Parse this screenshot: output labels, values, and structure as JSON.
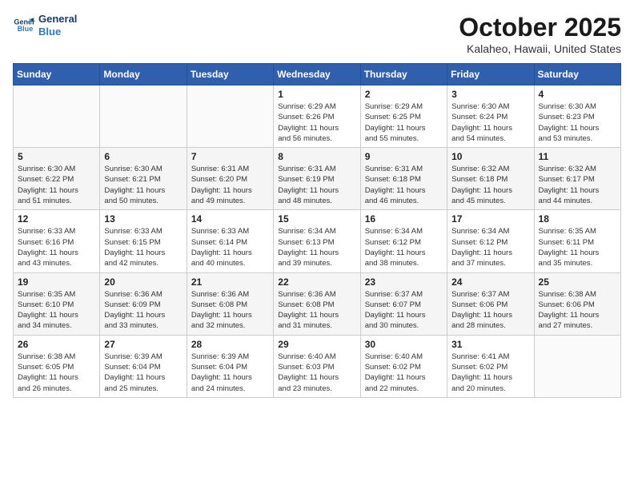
{
  "header": {
    "logo_line1": "General",
    "logo_line2": "Blue",
    "month": "October 2025",
    "location": "Kalaheo, Hawaii, United States"
  },
  "weekdays": [
    "Sunday",
    "Monday",
    "Tuesday",
    "Wednesday",
    "Thursday",
    "Friday",
    "Saturday"
  ],
  "weeks": [
    [
      {
        "day": "",
        "info": ""
      },
      {
        "day": "",
        "info": ""
      },
      {
        "day": "",
        "info": ""
      },
      {
        "day": "1",
        "info": "Sunrise: 6:29 AM\nSunset: 6:26 PM\nDaylight: 11 hours\nand 56 minutes."
      },
      {
        "day": "2",
        "info": "Sunrise: 6:29 AM\nSunset: 6:25 PM\nDaylight: 11 hours\nand 55 minutes."
      },
      {
        "day": "3",
        "info": "Sunrise: 6:30 AM\nSunset: 6:24 PM\nDaylight: 11 hours\nand 54 minutes."
      },
      {
        "day": "4",
        "info": "Sunrise: 6:30 AM\nSunset: 6:23 PM\nDaylight: 11 hours\nand 53 minutes."
      }
    ],
    [
      {
        "day": "5",
        "info": "Sunrise: 6:30 AM\nSunset: 6:22 PM\nDaylight: 11 hours\nand 51 minutes."
      },
      {
        "day": "6",
        "info": "Sunrise: 6:30 AM\nSunset: 6:21 PM\nDaylight: 11 hours\nand 50 minutes."
      },
      {
        "day": "7",
        "info": "Sunrise: 6:31 AM\nSunset: 6:20 PM\nDaylight: 11 hours\nand 49 minutes."
      },
      {
        "day": "8",
        "info": "Sunrise: 6:31 AM\nSunset: 6:19 PM\nDaylight: 11 hours\nand 48 minutes."
      },
      {
        "day": "9",
        "info": "Sunrise: 6:31 AM\nSunset: 6:18 PM\nDaylight: 11 hours\nand 46 minutes."
      },
      {
        "day": "10",
        "info": "Sunrise: 6:32 AM\nSunset: 6:18 PM\nDaylight: 11 hours\nand 45 minutes."
      },
      {
        "day": "11",
        "info": "Sunrise: 6:32 AM\nSunset: 6:17 PM\nDaylight: 11 hours\nand 44 minutes."
      }
    ],
    [
      {
        "day": "12",
        "info": "Sunrise: 6:33 AM\nSunset: 6:16 PM\nDaylight: 11 hours\nand 43 minutes."
      },
      {
        "day": "13",
        "info": "Sunrise: 6:33 AM\nSunset: 6:15 PM\nDaylight: 11 hours\nand 42 minutes."
      },
      {
        "day": "14",
        "info": "Sunrise: 6:33 AM\nSunset: 6:14 PM\nDaylight: 11 hours\nand 40 minutes."
      },
      {
        "day": "15",
        "info": "Sunrise: 6:34 AM\nSunset: 6:13 PM\nDaylight: 11 hours\nand 39 minutes."
      },
      {
        "day": "16",
        "info": "Sunrise: 6:34 AM\nSunset: 6:12 PM\nDaylight: 11 hours\nand 38 minutes."
      },
      {
        "day": "17",
        "info": "Sunrise: 6:34 AM\nSunset: 6:12 PM\nDaylight: 11 hours\nand 37 minutes."
      },
      {
        "day": "18",
        "info": "Sunrise: 6:35 AM\nSunset: 6:11 PM\nDaylight: 11 hours\nand 35 minutes."
      }
    ],
    [
      {
        "day": "19",
        "info": "Sunrise: 6:35 AM\nSunset: 6:10 PM\nDaylight: 11 hours\nand 34 minutes."
      },
      {
        "day": "20",
        "info": "Sunrise: 6:36 AM\nSunset: 6:09 PM\nDaylight: 11 hours\nand 33 minutes."
      },
      {
        "day": "21",
        "info": "Sunrise: 6:36 AM\nSunset: 6:08 PM\nDaylight: 11 hours\nand 32 minutes."
      },
      {
        "day": "22",
        "info": "Sunrise: 6:36 AM\nSunset: 6:08 PM\nDaylight: 11 hours\nand 31 minutes."
      },
      {
        "day": "23",
        "info": "Sunrise: 6:37 AM\nSunset: 6:07 PM\nDaylight: 11 hours\nand 30 minutes."
      },
      {
        "day": "24",
        "info": "Sunrise: 6:37 AM\nSunset: 6:06 PM\nDaylight: 11 hours\nand 28 minutes."
      },
      {
        "day": "25",
        "info": "Sunrise: 6:38 AM\nSunset: 6:06 PM\nDaylight: 11 hours\nand 27 minutes."
      }
    ],
    [
      {
        "day": "26",
        "info": "Sunrise: 6:38 AM\nSunset: 6:05 PM\nDaylight: 11 hours\nand 26 minutes."
      },
      {
        "day": "27",
        "info": "Sunrise: 6:39 AM\nSunset: 6:04 PM\nDaylight: 11 hours\nand 25 minutes."
      },
      {
        "day": "28",
        "info": "Sunrise: 6:39 AM\nSunset: 6:04 PM\nDaylight: 11 hours\nand 24 minutes."
      },
      {
        "day": "29",
        "info": "Sunrise: 6:40 AM\nSunset: 6:03 PM\nDaylight: 11 hours\nand 23 minutes."
      },
      {
        "day": "30",
        "info": "Sunrise: 6:40 AM\nSunset: 6:02 PM\nDaylight: 11 hours\nand 22 minutes."
      },
      {
        "day": "31",
        "info": "Sunrise: 6:41 AM\nSunset: 6:02 PM\nDaylight: 11 hours\nand 20 minutes."
      },
      {
        "day": "",
        "info": ""
      }
    ]
  ]
}
